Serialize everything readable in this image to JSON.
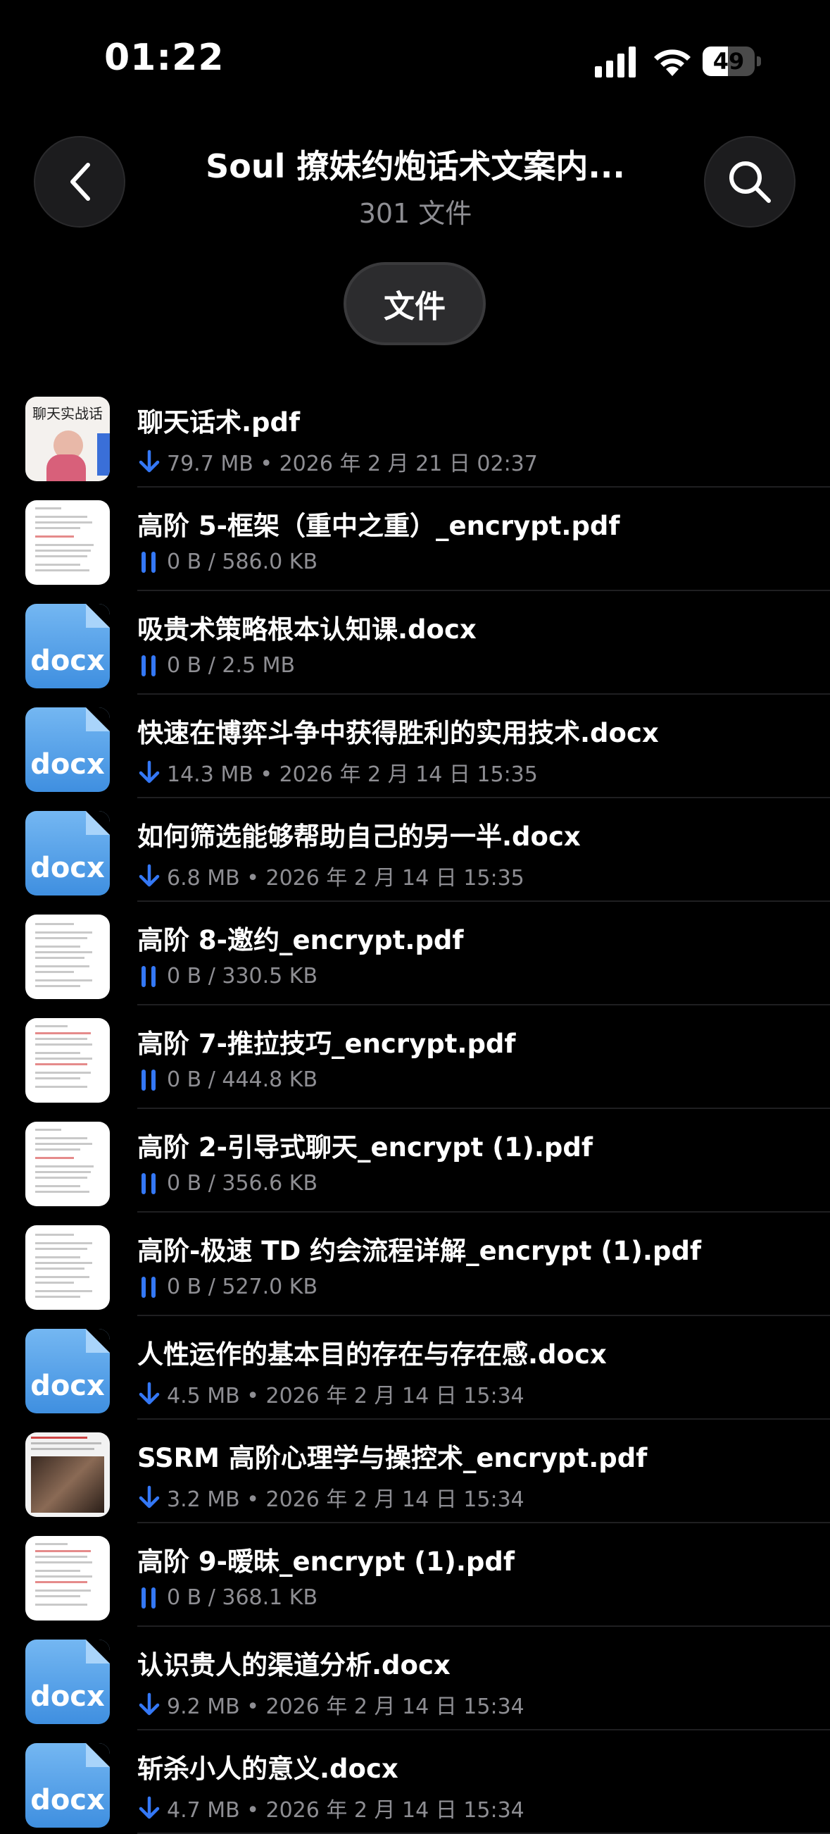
{
  "status_bar": {
    "time": "01:22",
    "battery": "49",
    "battery_level": 0.49
  },
  "header": {
    "title": "Soul 撩妹约炮话术文案内...",
    "subtitle": "301 文件"
  },
  "filter": {
    "label": "文件"
  },
  "colors": {
    "accent": "#3478f6",
    "secondary_text": "#8e8e93",
    "docx_blue": "#4a98e6"
  },
  "files": [
    {
      "name": "聊天话术.pdf",
      "status": "downloaded",
      "meta": "79.7 MB • 2026 年 2 月 21 日 02:37",
      "thumb": "cover",
      "thumb_text": "聊天实战话"
    },
    {
      "name": "高阶 5-框架（重中之重）_encrypt.pdf",
      "status": "paused",
      "meta": "0 B / 586.0 KB",
      "thumb": "pdf"
    },
    {
      "name": "吸贵术策略根本认知课.docx",
      "status": "paused",
      "meta": "0 B / 2.5 MB",
      "thumb": "docx",
      "thumb_text": "docx"
    },
    {
      "name": "快速在博弈斗争中获得胜利的实用技术.docx",
      "status": "downloaded",
      "meta": "14.3 MB • 2026 年 2 月 14 日 15:35",
      "thumb": "docx",
      "thumb_text": "docx"
    },
    {
      "name": "如何筛选能够帮助自己的另一半.docx",
      "status": "downloaded",
      "meta": "6.8 MB • 2026 年 2 月 14 日 15:35",
      "thumb": "docx",
      "thumb_text": "docx"
    },
    {
      "name": "高阶 8-邀约_encrypt.pdf",
      "status": "paused",
      "meta": "0 B / 330.5 KB",
      "thumb": "pdf"
    },
    {
      "name": "高阶 7-推拉技巧_encrypt.pdf",
      "status": "paused",
      "meta": "0 B / 444.8 KB",
      "thumb": "pdf"
    },
    {
      "name": "高阶 2-引导式聊天_encrypt (1).pdf",
      "status": "paused",
      "meta": "0 B / 356.6 KB",
      "thumb": "pdf"
    },
    {
      "name": "高阶-极速 TD 约会流程详解_encrypt (1).pdf",
      "status": "paused",
      "meta": "0 B / 527.0 KB",
      "thumb": "pdf"
    },
    {
      "name": "人性运作的基本目的存在与存在感.docx",
      "status": "downloaded",
      "meta": "4.5 MB • 2026 年 2 月 14 日 15:34",
      "thumb": "docx",
      "thumb_text": "docx"
    },
    {
      "name": "SSRM 高阶心理学与操控术_encrypt.pdf",
      "status": "downloaded",
      "meta": "3.2 MB • 2026 年 2 月 14 日 15:34",
      "thumb": "photo"
    },
    {
      "name": "高阶 9-暧昧_encrypt (1).pdf",
      "status": "paused",
      "meta": "0 B / 368.1 KB",
      "thumb": "pdf"
    },
    {
      "name": "认识贵人的渠道分析.docx",
      "status": "downloaded",
      "meta": "9.2 MB • 2026 年 2 月 14 日 15:34",
      "thumb": "docx",
      "thumb_text": "docx"
    },
    {
      "name": "斩杀小人的意义.docx",
      "status": "downloaded",
      "meta": "4.7 MB • 2026 年 2 月 14 日 15:34",
      "thumb": "docx",
      "thumb_text": "docx"
    }
  ]
}
